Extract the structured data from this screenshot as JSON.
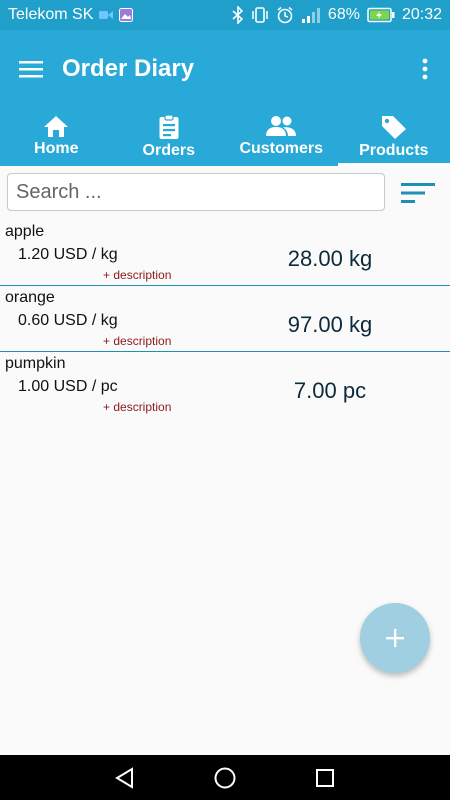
{
  "status_bar": {
    "carrier": "Telekom SK",
    "battery": "68%",
    "time": "20:32",
    "icons": [
      "video-call-icon",
      "gallery-icon",
      "bluetooth-icon",
      "vibrate-icon",
      "alarm-icon",
      "signal-icon",
      "battery-charging-icon"
    ]
  },
  "app_bar": {
    "title": "Order Diary",
    "menu_icon": "hamburger-menu-icon",
    "overflow_icon": "more-vert-icon"
  },
  "tabs": [
    {
      "label": "Home",
      "icon": "home-icon",
      "active": false
    },
    {
      "label": "Orders",
      "icon": "clipboard-icon",
      "active": false
    },
    {
      "label": "Customers",
      "icon": "people-icon",
      "active": false
    },
    {
      "label": "Products",
      "icon": "tag-icon",
      "active": true
    }
  ],
  "search": {
    "placeholder": "Search ...",
    "value": ""
  },
  "products": [
    {
      "name": "apple",
      "price": "1.20 USD / kg",
      "description_link": "+ description",
      "quantity": "28.00 kg"
    },
    {
      "name": "orange",
      "price": "0.60 USD / kg",
      "description_link": "+ description",
      "quantity": "97.00 kg"
    },
    {
      "name": "pumpkin",
      "price": "1.00 USD / pc",
      "description_link": "+ description",
      "quantity": "7.00 pc"
    }
  ],
  "fab": {
    "icon": "plus-icon"
  },
  "colors": {
    "primary": "#29a9d7",
    "status_bar": "#1f9fc9",
    "divider": "#1f8fb8",
    "description_link": "#8b1a1a",
    "fab": "#9fcfe0"
  }
}
